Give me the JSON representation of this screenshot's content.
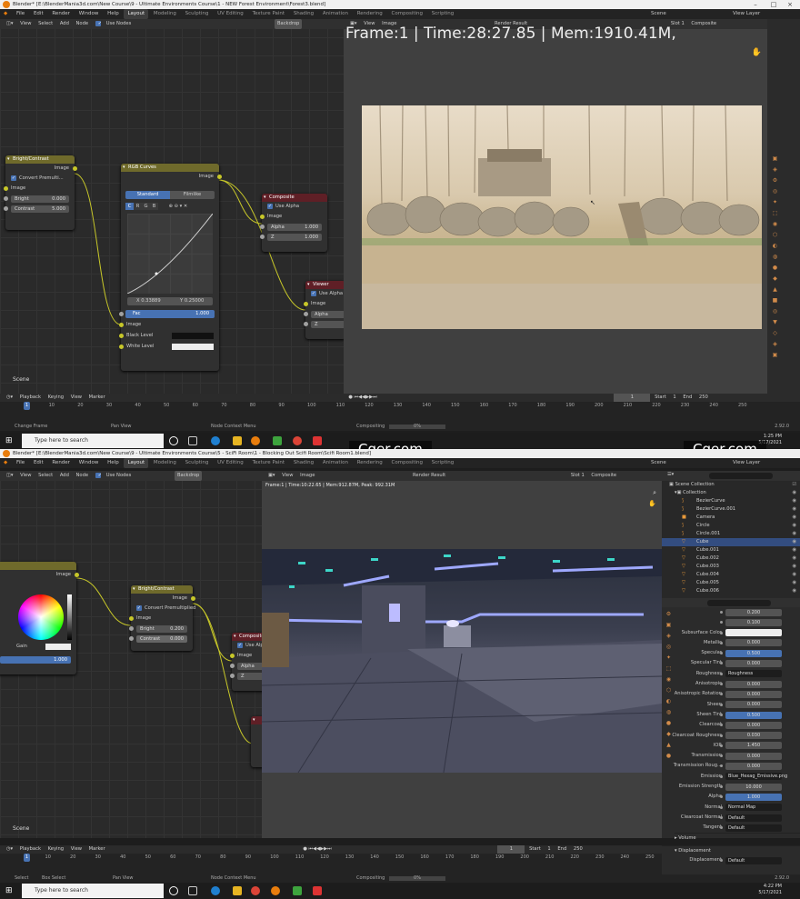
{
  "top": {
    "title": "Blender* [E:\\BlenderMania3d.com\\New Course\\9 - Ultimate Environments Course\\1 - NEW Forest Environment\\Forest3.blend]",
    "menu": [
      "File",
      "Edit",
      "Render",
      "Window",
      "Help"
    ],
    "workspaces": [
      "Layout",
      "Modeling",
      "Sculpting",
      "UV Editing",
      "Texture Paint",
      "Shading",
      "Animation",
      "Rendering",
      "Compositing",
      "Scripting"
    ],
    "scene": "Scene",
    "view_layer": "View Layer",
    "ne_header": [
      "View",
      "Select",
      "Add",
      "Node"
    ],
    "use_nodes": "Use Nodes",
    "backdrop": "Backdrop",
    "iv_header": [
      "View",
      "Image"
    ],
    "render_result": "Render Result",
    "slot": "Slot 1",
    "composite_sel": "Composite",
    "overlay_text": "Frame:1 | Time:28:27.85 | Mem:1910.41M,",
    "scene_label": "Scene",
    "bc": {
      "title": "Bright/Contrast",
      "out": "Image",
      "convert": "Convert Premulti...",
      "in": "Image",
      "bright_l": "Bright",
      "bright_v": "0.000",
      "contrast_l": "Contrast",
      "contrast_v": "5.000"
    },
    "rgb": {
      "title": "RGB Curves",
      "out": "Image",
      "tab1": "Standard",
      "tab2": "Filmlike",
      "chans": [
        "C",
        "R",
        "G",
        "B"
      ],
      "x": "X 0.33889",
      "y": "Y 0.25000",
      "fac_l": "Fac",
      "fac_v": "1.000",
      "in": "Image",
      "black": "Black Level",
      "white": "White Level"
    },
    "comp": {
      "title": "Composite",
      "use_alpha": "Use Alpha",
      "image": "Image",
      "alpha_l": "Alpha",
      "alpha_v": "1.000",
      "z_l": "Z",
      "z_v": "1.000"
    },
    "viewer": {
      "title": "Viewer",
      "use_alpha": "Use Alpha",
      "image": "Image",
      "alpha": "Alpha",
      "z": "Z"
    },
    "timeline": {
      "menu": [
        "Playback",
        "Keying",
        "View",
        "Marker"
      ],
      "frame": "1",
      "start_l": "Start",
      "start_v": "1",
      "end_l": "End",
      "end_v": "250",
      "ticks": [
        "10",
        "20",
        "30",
        "40",
        "50",
        "60",
        "70",
        "80",
        "90",
        "100",
        "110",
        "120",
        "130",
        "140",
        "150",
        "160",
        "170",
        "180",
        "190",
        "200",
        "210",
        "220",
        "230",
        "240",
        "250"
      ],
      "cur": "1"
    },
    "status": [
      "Change Frame",
      "Pan View",
      "Node Context Menu"
    ],
    "compositing": "Compositing",
    "pct": "0%",
    "version": "2.92.0",
    "search": "Type here to search",
    "watermark": "Cger.com",
    "time": "1:25 PM",
    "date": "5/17/2021"
  },
  "bottom": {
    "title": "Blender* [E:\\BlenderMania3d.com\\New Course\\9 - Ultimate Environments Course\\5 - SciFi Room\\1 - Blocking Out Scifi Room\\Scifi Room1.blend]",
    "menu": [
      "File",
      "Edit",
      "Render",
      "Window",
      "Help"
    ],
    "workspaces": [
      "Layout",
      "Modeling",
      "Sculpting",
      "UV Editing",
      "Texture Paint",
      "Shading",
      "Animation",
      "Rendering",
      "Compositing",
      "Scripting"
    ],
    "scene": "Scene",
    "view_layer": "View Layer",
    "ne_header": [
      "View",
      "Select",
      "Add",
      "Node"
    ],
    "use_nodes": "Use Nodes",
    "backdrop": "Backdrop",
    "iv_header": [
      "View",
      "Image"
    ],
    "render_result": "Render Result",
    "slot": "Slot 1",
    "composite_sel": "Composite",
    "frame_info": "Frame:1 | Time:10:22.65 | Mem:912.87M, Peak: 992.31M",
    "scene_label": "Scene",
    "cw": {
      "out": "Image",
      "gain": "Gain",
      "val": "1.000"
    },
    "bc": {
      "title": "Bright/Contrast",
      "out": "Image",
      "convert": "Convert Premultiplied",
      "in": "Image",
      "bright_l": "Bright",
      "bright_v": "0.200",
      "contrast_l": "Contrast",
      "contrast_v": "0.000"
    },
    "comp": {
      "title": "Composite",
      "use_alpha": "Use Alpha",
      "image": "Image",
      "alpha": "Alpha",
      "z": "Z"
    },
    "outliner": {
      "root": "Scene Collection",
      "collection": "Collection",
      "items": [
        "BezierCurve",
        "BezierCurve.001",
        "Camera",
        "Circle",
        "Circle.001",
        "Cube",
        "Cube.001",
        "Cube.002",
        "Cube.003",
        "Cube.004",
        "Cube.005",
        "Cube.006"
      ],
      "selected": "Cube"
    },
    "props": [
      {
        "l": "",
        "v": "0.200"
      },
      {
        "l": "",
        "v": "0.100"
      },
      {
        "l": "Subsurface Color",
        "v": "",
        "white": true
      },
      {
        "l": "Metallic",
        "v": "0.000"
      },
      {
        "l": "Specular",
        "v": "0.500",
        "blue": true
      },
      {
        "l": "Specular Tint",
        "v": "0.000"
      },
      {
        "l": "Roughness",
        "v": "Roughness",
        "dark": true
      },
      {
        "l": "Anisotropic",
        "v": "0.000"
      },
      {
        "l": "Anisotropic Rotation",
        "v": "0.000"
      },
      {
        "l": "Sheen",
        "v": "0.000"
      },
      {
        "l": "Sheen Tint",
        "v": "0.500",
        "blue": true
      },
      {
        "l": "Clearcoat",
        "v": "0.000"
      },
      {
        "l": "Clearcoat Roughness",
        "v": "0.030"
      },
      {
        "l": "IOR",
        "v": "1.450"
      },
      {
        "l": "Transmission",
        "v": "0.000"
      },
      {
        "l": "Transmission Roug...",
        "v": "0.000"
      },
      {
        "l": "Emission",
        "v": "Blue_Hexag_Emissive.png",
        "dark": true
      },
      {
        "l": "Emission Strength",
        "v": "10.000"
      },
      {
        "l": "Alpha",
        "v": "1.000",
        "blue": true
      },
      {
        "l": "Normal",
        "v": "Normal Map",
        "dark": true
      },
      {
        "l": "Clearcoat Normal",
        "v": "Default",
        "dark": true
      },
      {
        "l": "Tangent",
        "v": "Default",
        "dark": true
      }
    ],
    "volume": "Volume",
    "displacement": "Displacement",
    "disp_l": "Displacement",
    "disp_v": "Default",
    "timeline": {
      "menu": [
        "Playback",
        "Keying",
        "View",
        "Marker"
      ],
      "frame": "1",
      "start_l": "Start",
      "start_v": "1",
      "end_l": "End",
      "end_v": "250",
      "ticks": [
        "10",
        "20",
        "30",
        "40",
        "50",
        "60",
        "70",
        "80",
        "90",
        "100",
        "110",
        "120",
        "130",
        "140",
        "150",
        "160",
        "170",
        "180",
        "190",
        "200",
        "210",
        "220",
        "230",
        "240",
        "250"
      ],
      "cur": "1"
    },
    "status": [
      "Select",
      "Box Select",
      "Pan View",
      "Node Context Menu"
    ],
    "compositing": "Compositing",
    "pct": "0%",
    "version": "2.92.0",
    "search": "Type here to search",
    "time": "4:22 PM",
    "date": "5/17/2021"
  }
}
